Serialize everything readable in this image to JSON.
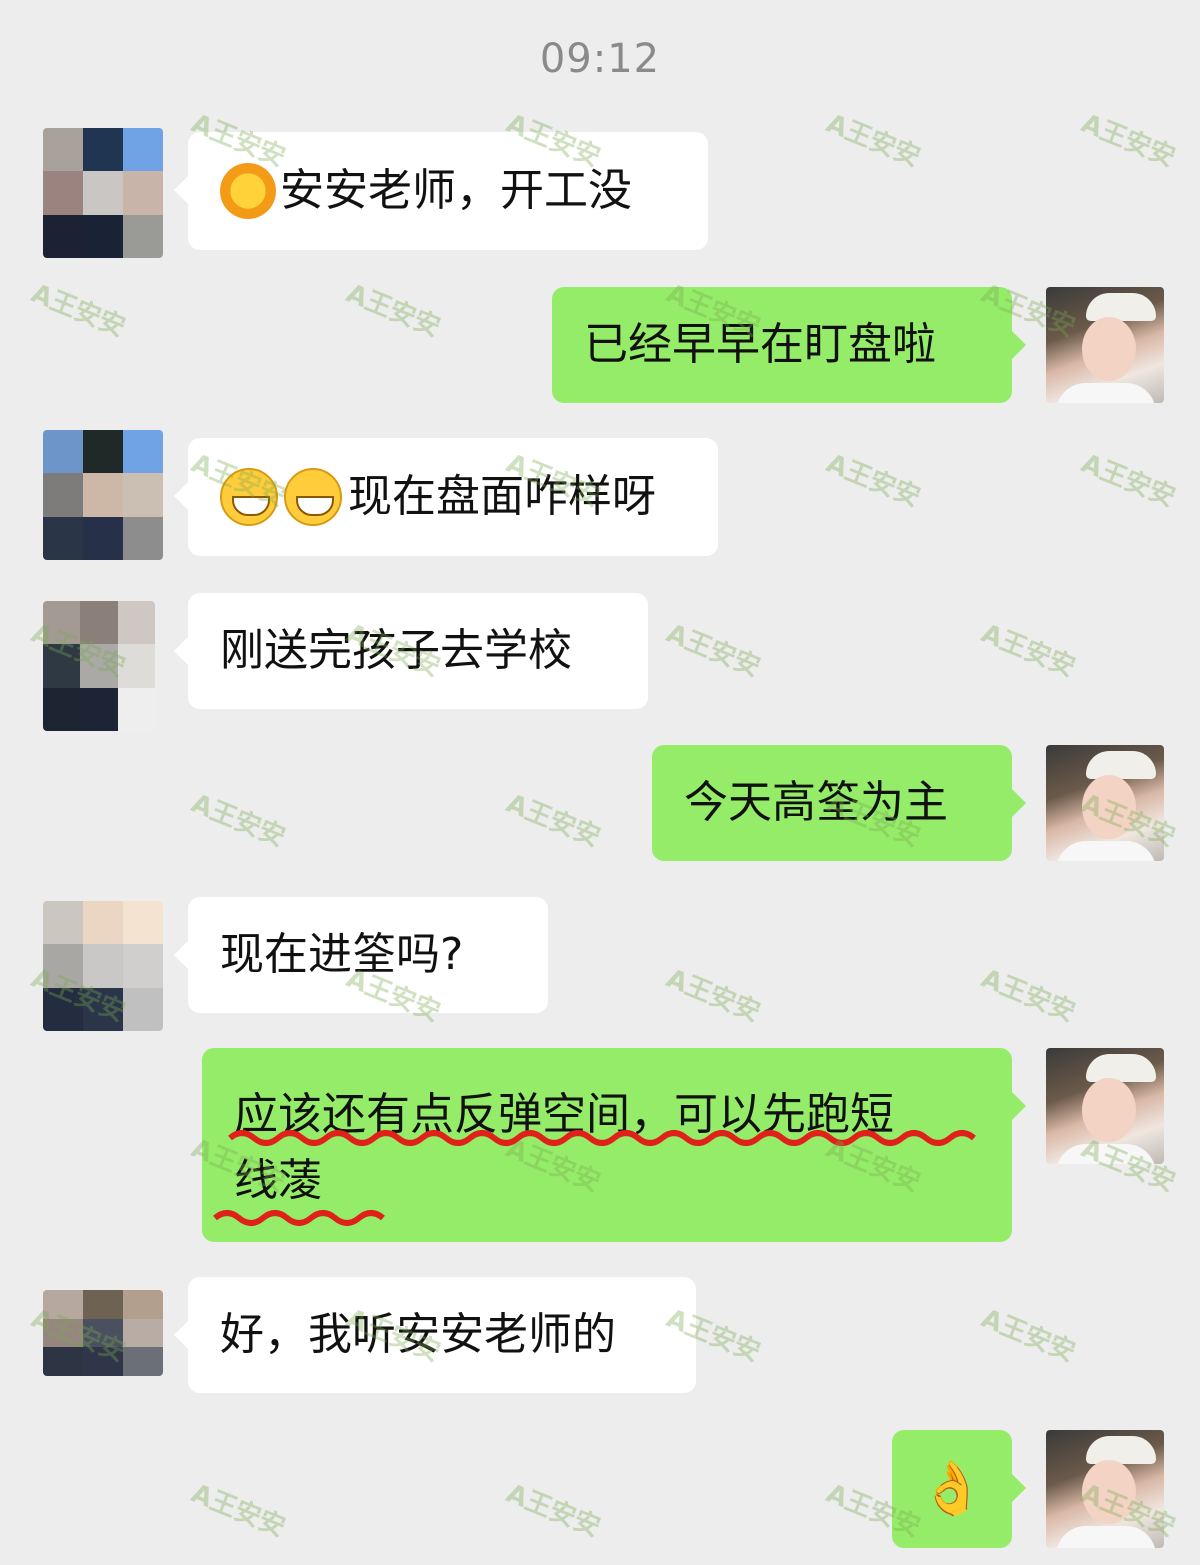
{
  "status": {
    "time": "09:12"
  },
  "colors": {
    "background": "#ededed",
    "incoming_bubble": "#ffffff",
    "outgoing_bubble": "#95ec69",
    "underline": "#e0201a"
  },
  "messages": [
    {
      "side": "in",
      "emoji": "sun-emoji",
      "text": "安安老师，开工没"
    },
    {
      "side": "out",
      "text": "已经早早在盯盘啦"
    },
    {
      "side": "in",
      "emoji": "grinning-emoji x2",
      "text": "现在盘面咋样呀"
    },
    {
      "side": "in",
      "text": "刚送完孩子去学校"
    },
    {
      "side": "out",
      "text": "今天高筌为主"
    },
    {
      "side": "in",
      "text": "现在进筌吗?"
    },
    {
      "side": "out",
      "line1": "应该还有点反弹空间，可以先跑短",
      "line2": "线蓤"
    },
    {
      "side": "in",
      "text": "好，我听安安老师的"
    },
    {
      "side": "out",
      "emoji": "ok-hand-emoji",
      "text": ""
    }
  ],
  "watermark": "A王安安"
}
